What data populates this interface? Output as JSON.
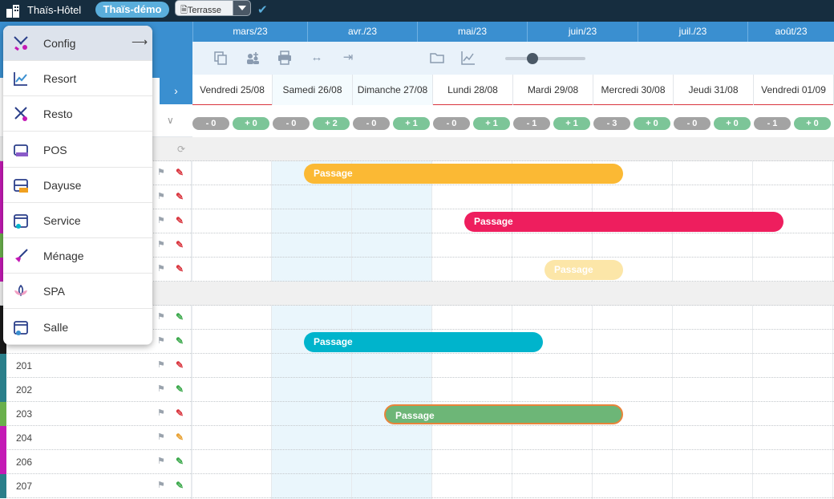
{
  "topbar": {
    "hotel_name": "Thaïs-Hôtel",
    "demo_badge": "Thaïs-démo",
    "terrasse_label": "Terrasse",
    "check_glyph": "✔"
  },
  "months": [
    "mars/23",
    "avr./23",
    "mai/23",
    "juin/23",
    "juil./23",
    "août/23"
  ],
  "toolbar": {
    "icons": [
      "copy-icon",
      "add-guest-icon",
      "print-icon",
      "expand-icon",
      "collapse-icon",
      "folder-icon",
      "chart-icon"
    ],
    "zoom_level": 0.35
  },
  "days": [
    "Vendredi 25/08",
    "Samedi 26/08",
    "Dimanche 27/08",
    "Lundi 28/08",
    "Mardi 29/08",
    "Mercredi 30/08",
    "Jeudi 31/08",
    "Vendredi 01/09"
  ],
  "counts": [
    [
      "- 0",
      "+ 0"
    ],
    [
      "- 0",
      "+ 2"
    ],
    [
      "- 0",
      "+ 1"
    ],
    [
      "- 0",
      "+ 1"
    ],
    [
      "- 1",
      "+ 1"
    ],
    [
      "- 3",
      "+ 0"
    ],
    [
      "- 0",
      "+ 0"
    ],
    [
      "- 1",
      "+ 0"
    ]
  ],
  "rows": [
    {
      "num": "",
      "section": true,
      "color": ""
    },
    {
      "num": "",
      "color": "#c41ab5",
      "pen": "#d9343d"
    },
    {
      "num": "",
      "color": "#c41ab5",
      "pen": "#d9343d"
    },
    {
      "num": "",
      "color": "#c41ab5",
      "pen": "#d9343d"
    },
    {
      "num": "",
      "color": "#6ab04c",
      "pen": "#d9343d"
    },
    {
      "num": "",
      "color": "#c41ab5",
      "pen": "#d9343d"
    },
    {
      "num": "",
      "section": true,
      "color": ""
    },
    {
      "num": "",
      "color": "#1a1a1a",
      "pen": "#3aa84a"
    },
    {
      "num": "",
      "color": "#1a1a1a",
      "pen": "#3aa84a"
    },
    {
      "num": "201",
      "color": "#2a7f8a",
      "pen": "#d9343d"
    },
    {
      "num": "202",
      "color": "#2a7f8a",
      "pen": "#3aa84a"
    },
    {
      "num": "203",
      "color": "#6ab04c",
      "pen": "#d9343d"
    },
    {
      "num": "204",
      "color": "#c41ab5",
      "pen": "#e8a030"
    },
    {
      "num": "206",
      "color": "#c41ab5",
      "pen": "#3aa84a"
    },
    {
      "num": "207",
      "color": "#2a7f8a",
      "pen": "#3aa84a"
    }
  ],
  "bookings": [
    {
      "label": "Passage",
      "color": "#fbb934"
    },
    {
      "label": "Passage",
      "color": "#ee1e5e"
    },
    {
      "label": "Passage",
      "color": "#fce6a8"
    },
    {
      "label": "Passage",
      "color": "#00b4cc"
    },
    {
      "label": "Passage",
      "color": "#6db677"
    }
  ],
  "menu": {
    "items": [
      {
        "label": "Config",
        "icon": "config-tools-icon",
        "active": true,
        "arrow": "⟶"
      },
      {
        "label": "Resort",
        "icon": "resort-chart-icon"
      },
      {
        "label": "Resto",
        "icon": "resto-cutlery-icon"
      },
      {
        "label": "POS",
        "icon": "pos-register-icon"
      },
      {
        "label": "Dayuse",
        "icon": "dayuse-bed-icon"
      },
      {
        "label": "Service",
        "icon": "service-calendar-icon"
      },
      {
        "label": "Ménage",
        "icon": "menage-broom-icon"
      },
      {
        "label": "SPA",
        "icon": "spa-lotus-icon"
      },
      {
        "label": "Salle",
        "icon": "salle-calendar-icon"
      }
    ]
  }
}
